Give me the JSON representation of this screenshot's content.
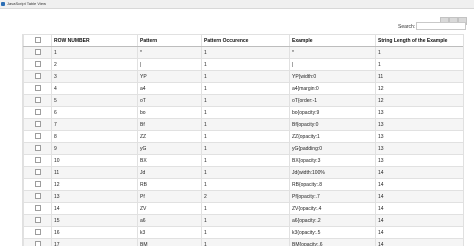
{
  "window": {
    "title": "JavaScript Table View"
  },
  "search": {
    "label": "Search:",
    "value": ""
  },
  "table": {
    "columns": [
      "",
      "ROW NUMBER",
      "Pattern",
      "Pattern Occurence",
      "Example",
      "String Length of the Example"
    ],
    "rows": [
      [
        "1",
        "*",
        "1",
        "*",
        "1"
      ],
      [
        "2",
        "|",
        "1",
        "|",
        "1"
      ],
      [
        "3",
        "YP",
        "1",
        "YP{width:0",
        "11"
      ],
      [
        "4",
        "a4",
        "1",
        "a4{margin:0",
        "12"
      ],
      [
        "5",
        "oT",
        "1",
        "oT{order:-1",
        "12"
      ],
      [
        "6",
        "bo",
        "1",
        "bo{opacity:9",
        "13"
      ],
      [
        "7",
        "Bf",
        "1",
        "Bf{opacity:0",
        "13"
      ],
      [
        "8",
        "ZZ",
        "1",
        "ZZ{opacity:1",
        "13"
      ],
      [
        "9",
        "yG",
        "1",
        "yG{padding:0",
        "13"
      ],
      [
        "10",
        "BX",
        "1",
        "BX{opacity:3",
        "13"
      ],
      [
        "11",
        "Jd",
        "1",
        "Jd{width:100%",
        "14"
      ],
      [
        "12",
        "RB",
        "1",
        "RB{opacity:.8",
        "14"
      ],
      [
        "13",
        "Pf",
        "2",
        "Pf{opacity:.7",
        "14"
      ],
      [
        "14",
        "ZV",
        "1",
        "ZV{opacity:.4",
        "14"
      ],
      [
        "15",
        "a6",
        "1",
        "a6{opacity:.2",
        "14"
      ],
      [
        "16",
        "k3",
        "1",
        "k3{opacity:.5",
        "14"
      ],
      [
        "17",
        "BM",
        "1",
        "BM{opacity:.6",
        "14"
      ]
    ]
  }
}
